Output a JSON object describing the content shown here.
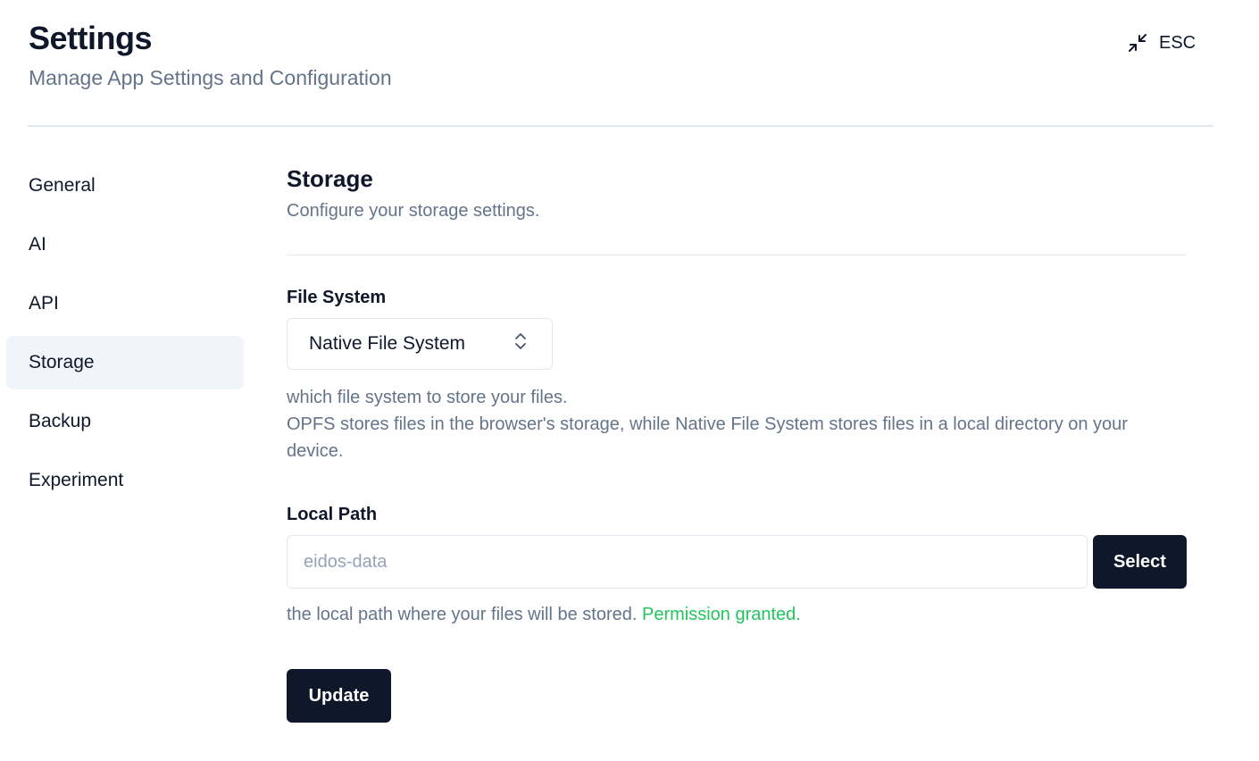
{
  "header": {
    "title": "Settings",
    "subtitle": "Manage App Settings and Configuration",
    "esc_label": "ESC"
  },
  "sidebar": {
    "items": [
      {
        "label": "General",
        "active": false
      },
      {
        "label": "AI",
        "active": false
      },
      {
        "label": "API",
        "active": false
      },
      {
        "label": "Storage",
        "active": true
      },
      {
        "label": "Backup",
        "active": false
      },
      {
        "label": "Experiment",
        "active": false
      }
    ]
  },
  "storage": {
    "title": "Storage",
    "description": "Configure your storage settings.",
    "file_system": {
      "label": "File System",
      "selected": "Native File System",
      "help_line1": "which file system to store your files.",
      "help_line2": "OPFS stores files in the browser's storage, while Native File System stores files in a local directory on your device."
    },
    "local_path": {
      "label": "Local Path",
      "placeholder": "eidos-data",
      "value": "",
      "select_label": "Select",
      "help": "the local path where your files will be stored.",
      "permission": "Permission granted."
    },
    "update_label": "Update"
  },
  "colors": {
    "primary": "#0f172a",
    "muted_text": "#64748b",
    "border": "#e2e8f0",
    "active_bg": "#f1f5f9",
    "success": "#22c55e"
  },
  "icons": {
    "esc": "minimize-arrows-icon",
    "select": "chevron-up-down-icon"
  }
}
